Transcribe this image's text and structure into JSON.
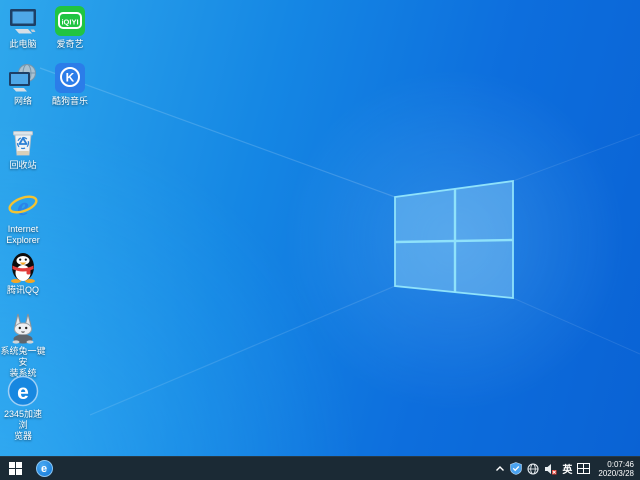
{
  "wallpaper": {
    "name": "windows-10-light-default",
    "logo": "windows-logo"
  },
  "desktop": {
    "icons": [
      {
        "id": "this-pc",
        "label": "此电脑"
      },
      {
        "id": "iqiyi",
        "label": "爱奇艺"
      },
      {
        "id": "network",
        "label": "网络"
      },
      {
        "id": "kugou-music",
        "label": "酷狗音乐"
      },
      {
        "id": "recycle-bin",
        "label": "回收站"
      },
      {
        "id": "internet-explorer",
        "label": "Internet\nExplorer"
      },
      {
        "id": "tencent-qq",
        "label": "腾讯QQ"
      },
      {
        "id": "xitongtu-installer",
        "label": "系统兔一键安\n装系统"
      },
      {
        "id": "2345-browser",
        "label": "2345加速浏\n览器"
      }
    ]
  },
  "icon_glyphs": {
    "iqiyi_logo_text": "iQIYI",
    "kugou_letter": "K",
    "ie_letter": "e",
    "browser_letter": "e",
    "taskbar_browser_letter": "e"
  },
  "taskbar": {
    "start_tooltip": "start",
    "tray": {
      "ime_label": "英",
      "clock_time": "0:07:46",
      "clock_date": "2020/3/28"
    }
  },
  "colors": {
    "wallpaper_light": "#2fa8ec",
    "wallpaper_deep": "#0a62d4",
    "logo_edge": "#8fe2fb",
    "taskbar_bg": "#1b2a35",
    "iqiyi_green": "#21c442",
    "kugou_blue": "#2b7de9",
    "browser_blue": "#1787e0",
    "ie_blue": "#2a84e8",
    "ie_gold": "#f3c332",
    "qq_scarf_red": "#e23c3c",
    "shield_blue": "#4aa3f0",
    "speaker_badge_red": "#e03a2f"
  }
}
